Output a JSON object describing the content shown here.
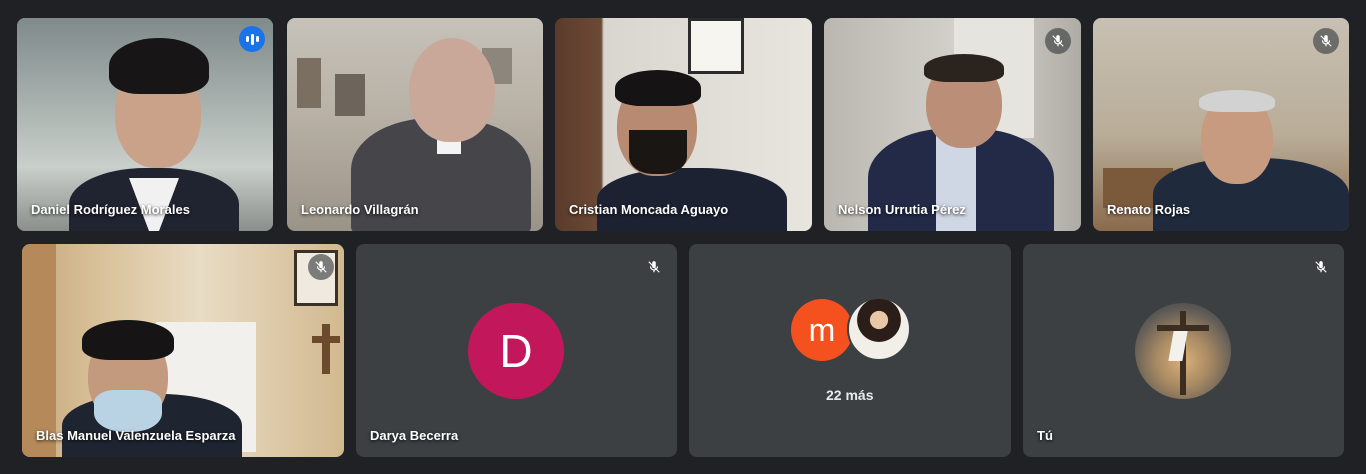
{
  "participants": [
    {
      "name": "Daniel Rodríguez Morales",
      "status": "speaking"
    },
    {
      "name": "Leonardo Villagrán"
    },
    {
      "name": "Cristian Moncada Aguayo"
    },
    {
      "name": "Nelson Urrutia Pérez",
      "status": "muted"
    },
    {
      "name": "Renato Rojas",
      "status": "muted"
    },
    {
      "name": "Blas Manuel Valenzuela Esparza",
      "status": "muted"
    },
    {
      "name": "Darya Becerra",
      "status": "muted",
      "initial": "D"
    },
    {
      "group_initial": "m",
      "more_label": "22 más"
    },
    {
      "name": "Tú",
      "status": "muted"
    }
  ],
  "colors": {
    "background": "#202124",
    "tile": "#3c4043",
    "active_outline": "#8ab4f8",
    "speaking": "#1a73e8",
    "avatar_d": "#c2185b",
    "avatar_m": "#f4511e"
  },
  "icons": {
    "muted": "mic-off-icon",
    "speaking": "audio-level-icon"
  }
}
